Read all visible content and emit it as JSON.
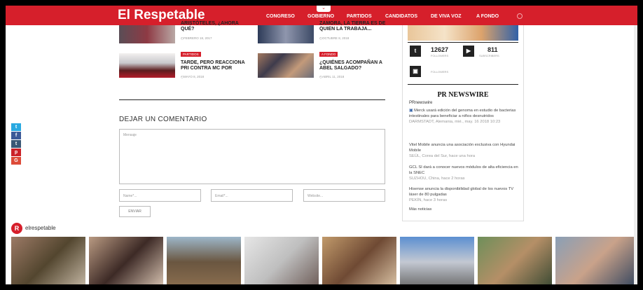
{
  "header": {
    "logo": "El Respetable",
    "nav": [
      "CONGRESO",
      "GOBIERNO",
      "PARTIDOS",
      "CANDIDATOS",
      "DE VIVA VOZ",
      "A FONDO"
    ]
  },
  "posts": [
    {
      "title": "ARISTÓTELES, ¿AHORA QUÉ?",
      "date": "FEBRERO 18, 2017"
    },
    {
      "title": "ZAMORA, LA TIERRA ES DE QUIEN LA TRABAJA...",
      "date": "OCTUBRE 8, 2018"
    },
    {
      "category": "PARTIDOS",
      "title": "TARDE, PERO REACCIONA PRI CONTRA MC POR",
      "date": "MAYO 8, 2018"
    },
    {
      "category": "A FONDO",
      "title": "¿QUIÉNES ACOMPAÑAN A ABEL SALGADO?",
      "date": "ABRIL 11, 2018"
    }
  ],
  "comment_form": {
    "title": "DEJAR UN COMENTARIO",
    "message_placeholder": "Mensaje",
    "name_placeholder": "Name*...",
    "email_placeholder": "Email*...",
    "website_placeholder": "Website...",
    "send_label": "ENVIAR"
  },
  "sidebar": {
    "twitter_count": "12627",
    "twitter_label": "FOLLOWERS",
    "youtube_count": "811",
    "youtube_label": "SUBSCRIBERS",
    "instagram_label": "FOLLOWERS",
    "pr_title": "PR NEWSWIRE",
    "pr_brand": "PRnewswire",
    "news": [
      {
        "text": "Merck usará edición del genoma en estudio de bacterias intestinales para beneficiar a niños desnutridos",
        "loc": "DARMSTADT, Alemania, mié., may. 16 2018 10:23"
      },
      {
        "text": "Vitel Mobile anuncia una asociación exclusiva con Hyundai Mobile",
        "loc": "SEÚL, Corea del Sur, hace una hora"
      },
      {
        "text": "GCL SI dará a conocer nuevos módulos de alta eficiencia en la SNEC",
        "loc": "SUZHOU, China, hace 2 horas"
      },
      {
        "text": "Hisense anuncia la disponibilidad global de los nuevos TV láser de 80 pulgadas",
        "loc": "PEKÍN, hace 3 horas"
      }
    ],
    "more": "Más noticias"
  },
  "social_icons": [
    {
      "icon": "twitter-icon",
      "glyph": "t",
      "color": "#29a9e1"
    },
    {
      "icon": "facebook-icon",
      "glyph": "f",
      "color": "#3b5998"
    },
    {
      "icon": "tumblr-icon",
      "glyph": "t",
      "color": "#3a5876"
    },
    {
      "icon": "pinterest-icon",
      "glyph": "p",
      "color": "#cb2027"
    },
    {
      "icon": "googleplus-icon",
      "glyph": "G",
      "color": "#dd4b39"
    }
  ],
  "instagram": {
    "handle": "elrespetable"
  },
  "colors": {
    "brand": "#d61f2b"
  }
}
